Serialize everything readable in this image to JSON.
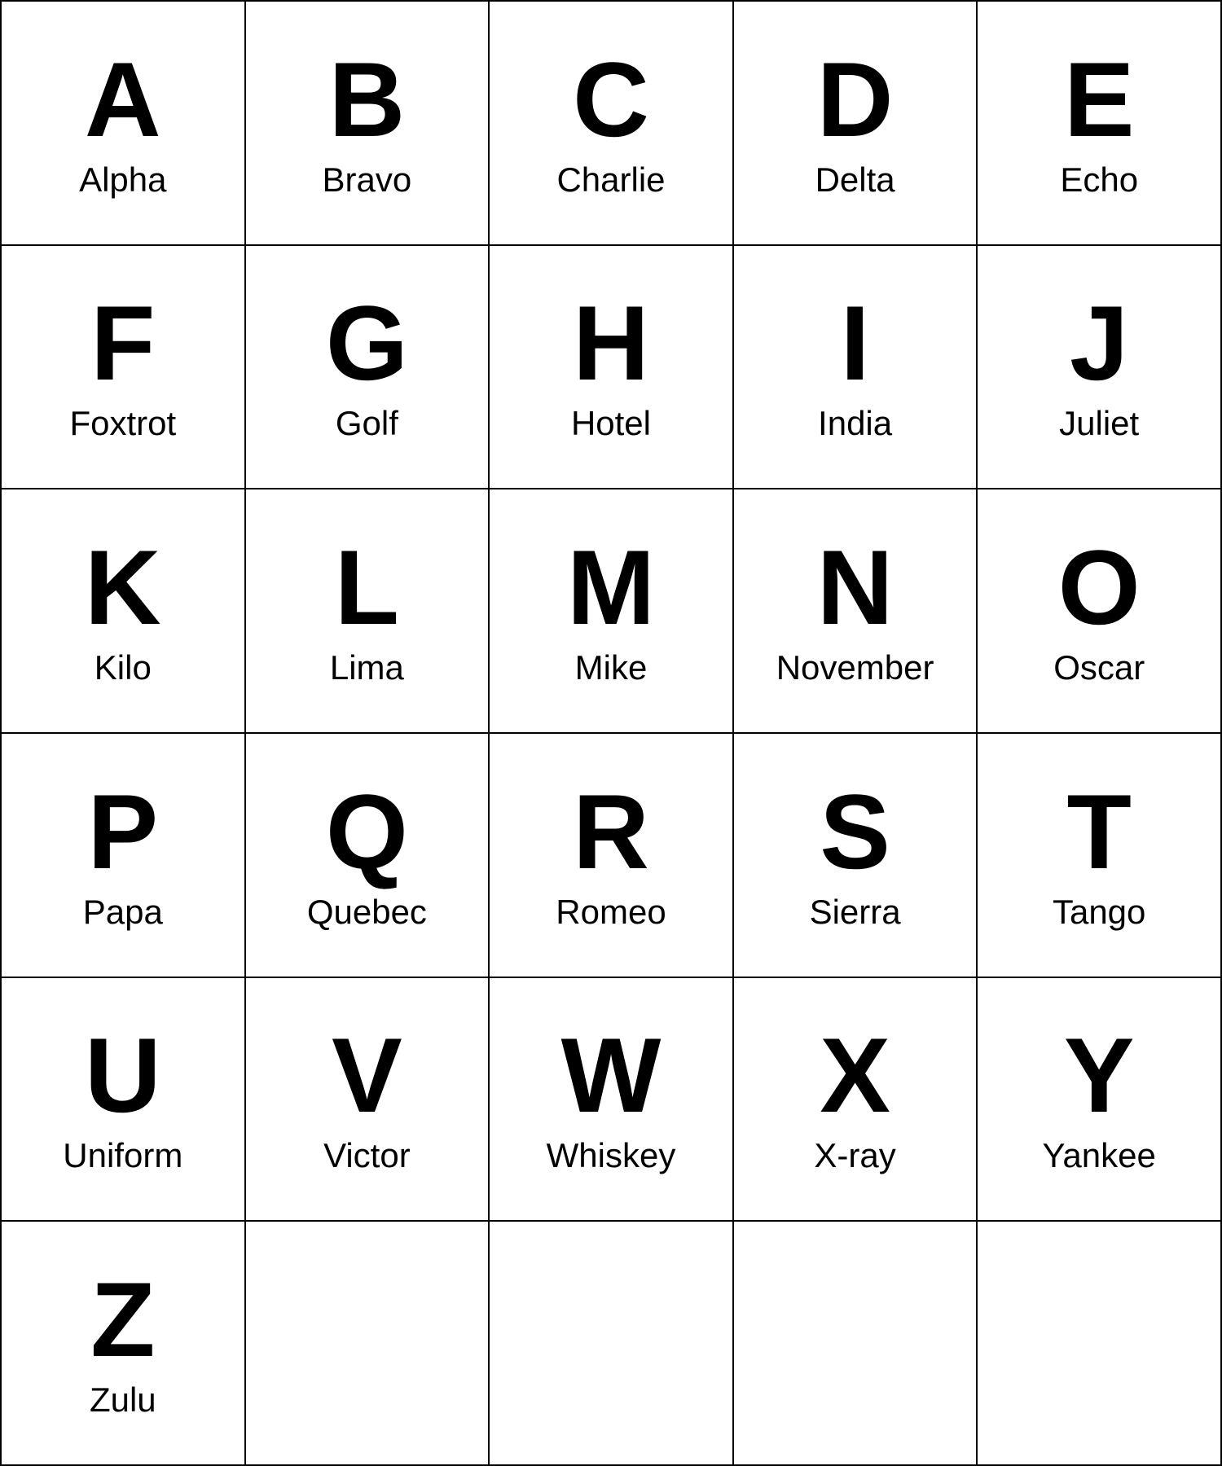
{
  "alphabet": [
    {
      "letter": "A",
      "word": "Alpha"
    },
    {
      "letter": "B",
      "word": "Bravo"
    },
    {
      "letter": "C",
      "word": "Charlie"
    },
    {
      "letter": "D",
      "word": "Delta"
    },
    {
      "letter": "E",
      "word": "Echo"
    },
    {
      "letter": "F",
      "word": "Foxtrot"
    },
    {
      "letter": "G",
      "word": "Golf"
    },
    {
      "letter": "H",
      "word": "Hotel"
    },
    {
      "letter": "I",
      "word": "India"
    },
    {
      "letter": "J",
      "word": "Juliet"
    },
    {
      "letter": "K",
      "word": "Kilo"
    },
    {
      "letter": "L",
      "word": "Lima"
    },
    {
      "letter": "M",
      "word": "Mike"
    },
    {
      "letter": "N",
      "word": "November"
    },
    {
      "letter": "O",
      "word": "Oscar"
    },
    {
      "letter": "P",
      "word": "Papa"
    },
    {
      "letter": "Q",
      "word": "Quebec"
    },
    {
      "letter": "R",
      "word": "Romeo"
    },
    {
      "letter": "S",
      "word": "Sierra"
    },
    {
      "letter": "T",
      "word": "Tango"
    },
    {
      "letter": "U",
      "word": "Uniform"
    },
    {
      "letter": "V",
      "word": "Victor"
    },
    {
      "letter": "W",
      "word": "Whiskey"
    },
    {
      "letter": "X",
      "word": "X-ray"
    },
    {
      "letter": "Y",
      "word": "Yankee"
    },
    {
      "letter": "Z",
      "word": "Zulu"
    }
  ]
}
